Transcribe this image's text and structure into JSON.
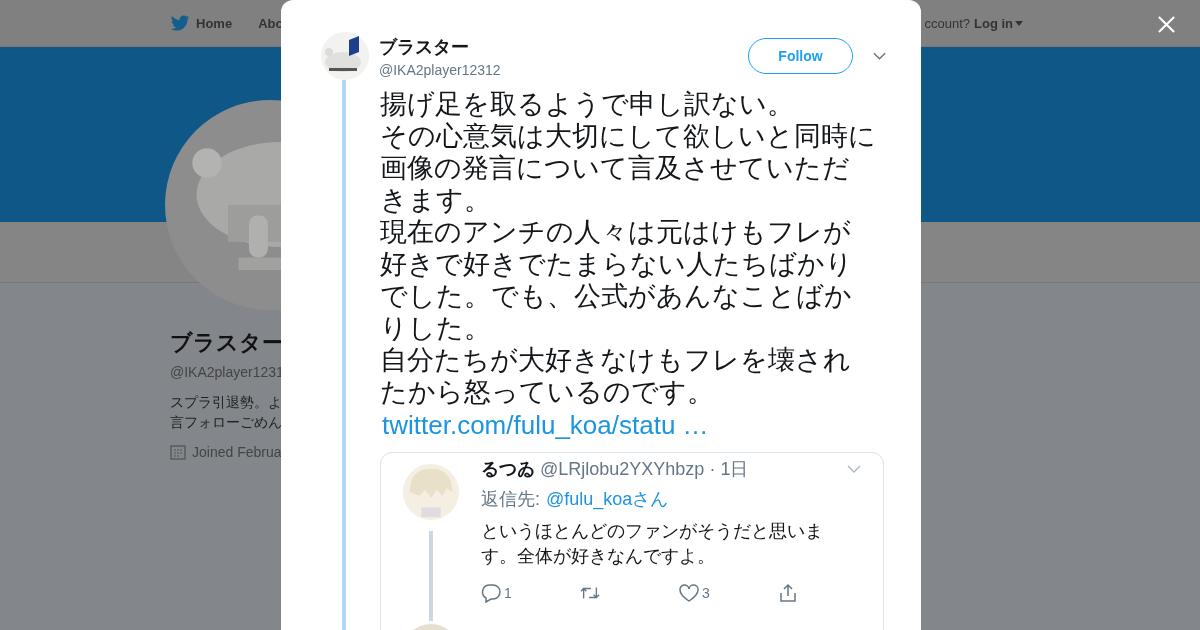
{
  "background_page": {
    "nav": {
      "items": [
        {
          "label": "Home",
          "kind": "home"
        },
        {
          "label": "Abo",
          "kind": "plain"
        }
      ],
      "account_prompt": "ccount?",
      "login": "Log in"
    },
    "profile": {
      "name": "ブラスター",
      "handle": "@IKA2player1231",
      "bio": [
        "スプラ引退勢。よ",
        "言フォローごめん"
      ],
      "joined": "Joined Februa"
    }
  },
  "tweet": {
    "author": "ブラスター",
    "handle": "@IKA2player12312",
    "follow_label": "Follow",
    "text_lines": [
      "揚げ足を取るようで申し訳ない。",
      "その心意気は大切にして欲しいと同時に",
      "画像の発言について言及させていただ",
      "きます。",
      "現在のアンチの人々は元はけもフレが",
      "好きで好きでたまらない人たちばかり",
      "でした。でも、公式があんなことばか",
      "りした。",
      "自分たちが大好きなけもフレを壊され",
      "たから怒っているのです。"
    ],
    "link": "twitter.com/fulu_koa/statu …",
    "embedded_screenshot": {
      "name": "るつゐ",
      "handle": "@LRjlobu2YXYhbzp",
      "separator": "·",
      "time": "1日",
      "reply_prefix": "返信先:",
      "reply_to": "@fulu_koaさん",
      "text": "というほとんどのファンがそうだと思います。全体が好きなんですよ。",
      "reply_count": "1",
      "like_count": "3"
    }
  }
}
